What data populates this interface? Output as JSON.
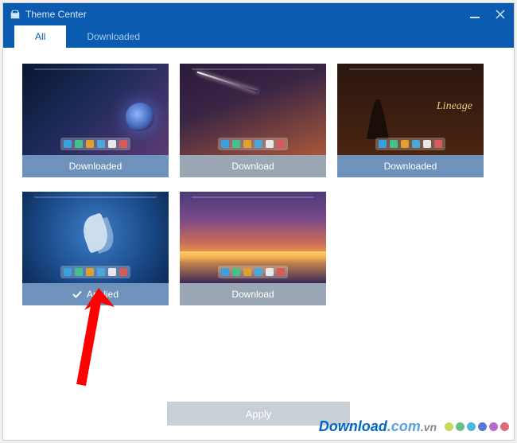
{
  "window": {
    "title": "Theme Center"
  },
  "tabs": [
    {
      "label": "All",
      "active": true
    },
    {
      "label": "Downloaded",
      "active": false
    }
  ],
  "themes": [
    {
      "status": "Downloaded",
      "status_kind": "downloaded",
      "thumb": "t-space"
    },
    {
      "status": "Download",
      "status_kind": "download",
      "thumb": "t-comet"
    },
    {
      "status": "Downloaded",
      "status_kind": "downloaded",
      "thumb": "t-lineage"
    },
    {
      "status": "Applied",
      "status_kind": "applied",
      "thumb": "t-feather"
    },
    {
      "status": "Download",
      "status_kind": "download",
      "thumb": "t-sunset"
    }
  ],
  "footer": {
    "apply_label": "Apply"
  },
  "watermark": {
    "text_main": "Download",
    "text_suffix": ".com",
    "text_tld": ".vn"
  },
  "dock_colors": [
    "#3aa0e0",
    "#45c08a",
    "#e0a030",
    "#4aa8d8",
    "#e8e8e8",
    "#d85a5a"
  ],
  "wm_dot_colors": [
    "#c8d858",
    "#68c088",
    "#48b8e0",
    "#5878d8",
    "#b868c8",
    "#e06878"
  ]
}
